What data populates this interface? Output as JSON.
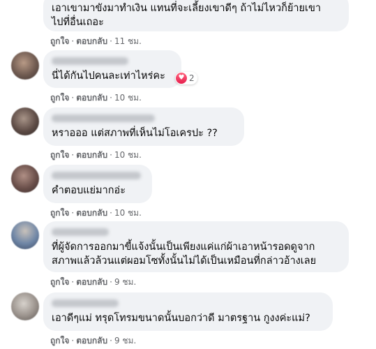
{
  "actions": {
    "like": "ถูกใจ",
    "reply": "ตอบกลับ",
    "sep": "·"
  },
  "comments": [
    {
      "text": "เอาเขามาขังมาทำเงิน แทนที่จะเลี้ยงเขาดีๆ ถ้าไม่ไหวก็ย้ายเขา\nไปที่อื่นเถอะ",
      "time": "11 ชม."
    },
    {
      "text": "นี่ได้กันไปคนละเท่าไหร่คะ",
      "time": "10 ชม.",
      "reaction_count": "2",
      "reaction_icon": "love-icon"
    },
    {
      "text": "หราอออ แต่สภาพที่เห็นไม่โอเครปะ ??",
      "time": "10 ชม."
    },
    {
      "text": "คำตอบแย่มากอ่ะ",
      "time": "10 ชม."
    },
    {
      "text": "ที่ผู้จัดการออกมาขี้แจ้งนั้นเป็นเพียงแค่แก่ผ้าเอาหน้ารอดดูจาก\nสภาพแล้วล้วนแต่ผอมโซทั้งนั้นไม่ได้เป็นเหมือนที่กล่าวอ้างเลย",
      "time": "9 ชม."
    },
    {
      "text": "เอาดีๆแม่ ทรุดโทรมขนาดนั้นบอกว่าดี มาตรฐาน กูงงค่ะแม่?",
      "time": "9 ชม."
    }
  ]
}
